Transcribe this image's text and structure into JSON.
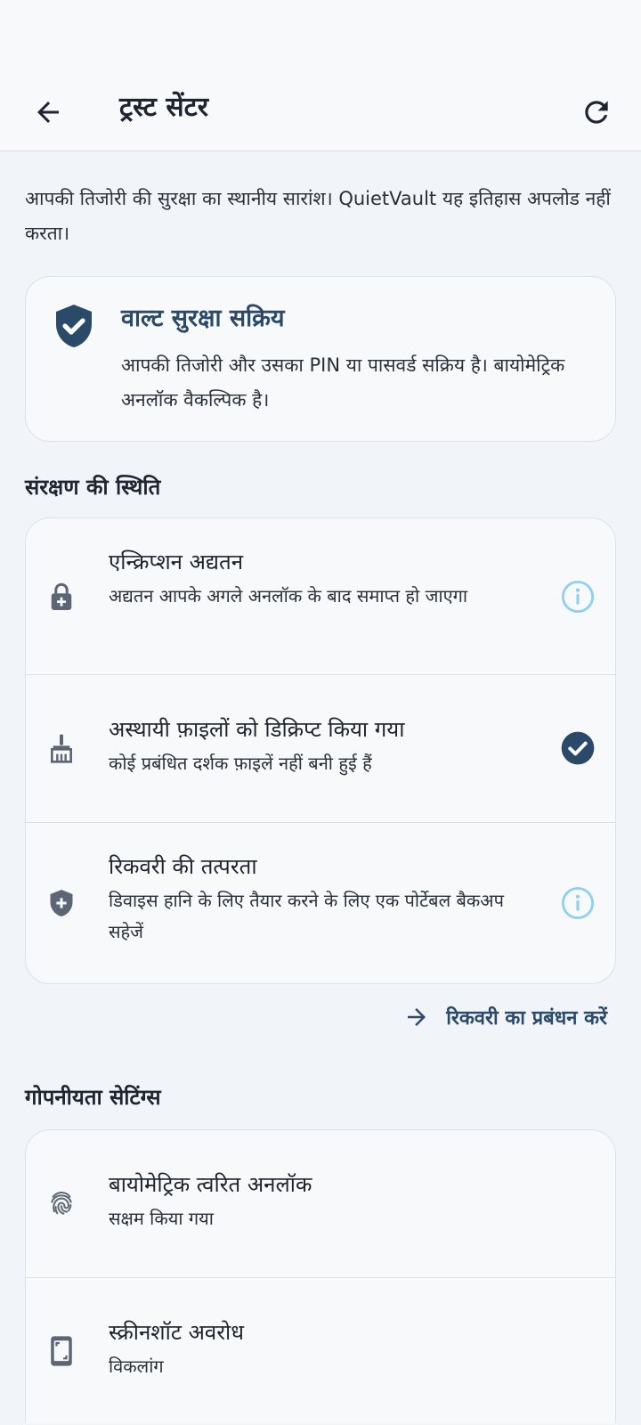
{
  "header": {
    "title": "ट्रस्ट सेंटर",
    "back_icon": "arrow-back-icon",
    "refresh_icon": "refresh-icon"
  },
  "intro_text": "आपकी तिजोरी की सुरक्षा का स्थानीय सारांश। QuietVault यह इतिहास अपलोड नहीं करता।",
  "summary": {
    "icon": "shield-check-icon",
    "title": "वाल्ट सुरक्षा सक्रिय",
    "body": "आपकी तिजोरी और उसका PIN या पासवर्ड सक्रिय है। बायोमेट्रिक अनलॉक वैकल्पिक है।"
  },
  "protection": {
    "section_title": "संरक्षण की स्थिति",
    "items": [
      {
        "icon": "lock-icon",
        "title": "एन्क्रिप्शन अद्यतन",
        "subtitle": "अद्यतन आपके अगले अनलॉक के बाद समाप्त हो जाएगा",
        "status_icon": "info-icon"
      },
      {
        "icon": "broom-icon",
        "title": "अस्थायी फ़ाइलों को डिक्रिप्ट किया गया",
        "subtitle": "कोई प्रबंधित दर्शक फ़ाइलें नहीं बनी हुई हैं",
        "status_icon": "check-circle-icon"
      },
      {
        "icon": "shield-plus-icon",
        "title": "रिकवरी की तत्परता",
        "subtitle": "डिवाइस हानि के लिए तैयार करने के लिए एक पोर्टेबल बैकअप सहेजें",
        "status_icon": "info-icon"
      }
    ],
    "manage_link": "रिकवरी का प्रबंधन करें"
  },
  "privacy": {
    "section_title": "गोपनीयता सेटिंग्स",
    "items": [
      {
        "icon": "fingerprint-icon",
        "title": "बायोमेट्रिक त्वरित अनलॉक",
        "subtitle": "सक्षम किया गया"
      },
      {
        "icon": "screenshot-block-icon",
        "title": "स्क्रीनशॉट अवरोध",
        "subtitle": "विकलांग"
      }
    ]
  },
  "colors": {
    "accent": "#2b4a69",
    "info": "#8fd0f2",
    "background": "#f1f5f9",
    "card": "#f7f9fb"
  }
}
